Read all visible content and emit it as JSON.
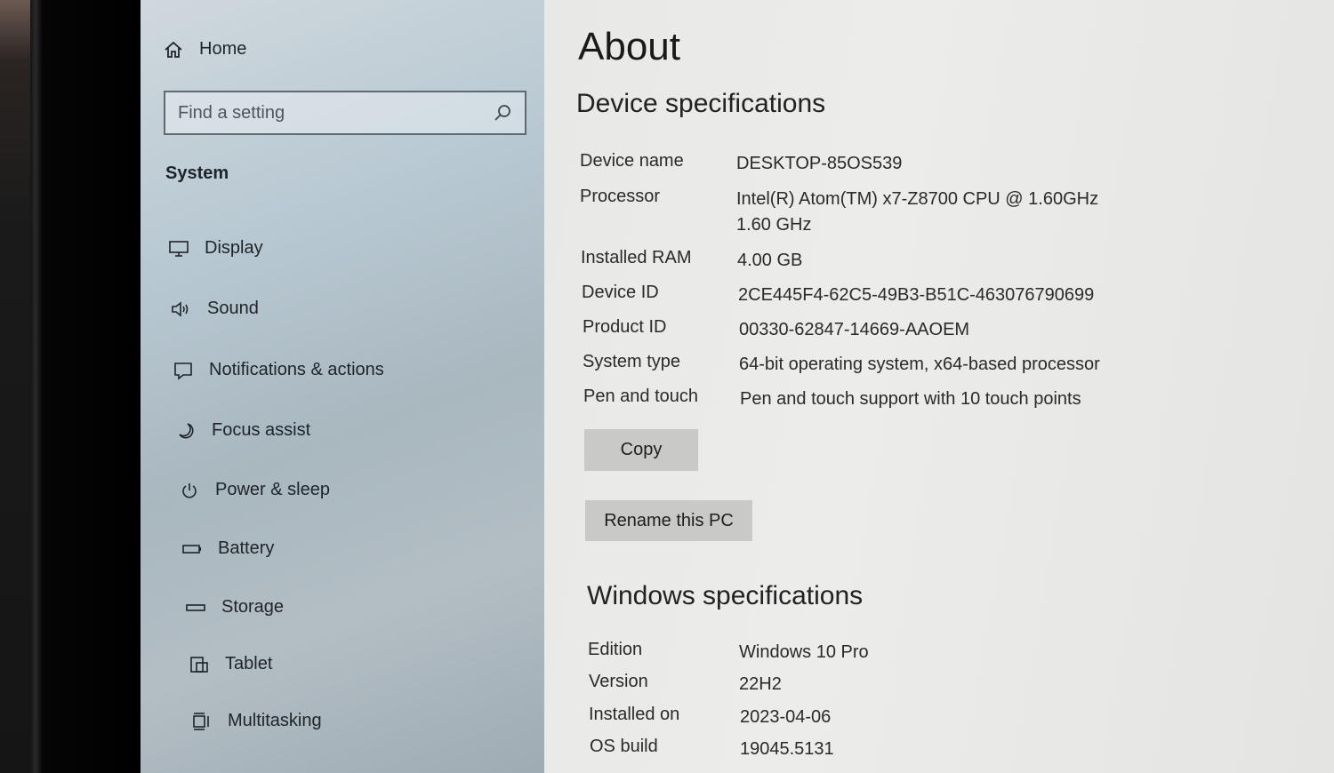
{
  "nav": {
    "home_label": "Home",
    "search_placeholder": "Find a setting",
    "section_label": "System",
    "items": [
      {
        "label": "Display",
        "icon": "monitor-icon"
      },
      {
        "label": "Sound",
        "icon": "speaker-icon"
      },
      {
        "label": "Notifications & actions",
        "icon": "notification-icon"
      },
      {
        "label": "Focus assist",
        "icon": "moon-icon"
      },
      {
        "label": "Power & sleep",
        "icon": "power-icon"
      },
      {
        "label": "Battery",
        "icon": "battery-icon"
      },
      {
        "label": "Storage",
        "icon": "storage-icon"
      },
      {
        "label": "Tablet",
        "icon": "tablet-icon"
      },
      {
        "label": "Multitasking",
        "icon": "multitasking-icon"
      }
    ]
  },
  "main": {
    "title": "About",
    "device_heading": "Device specifications",
    "device_specs": [
      {
        "key": "Device name",
        "value": "DESKTOP-85OS539"
      },
      {
        "key": "Processor",
        "value": "Intel(R) Atom(TM) x7-Z8700  CPU @ 1.60GHz",
        "value2": "1.60 GHz"
      },
      {
        "key": "Installed RAM",
        "value": "4.00 GB"
      },
      {
        "key": "Device ID",
        "value": "2CE445F4-62C5-49B3-B51C-463076790699"
      },
      {
        "key": "Product ID",
        "value": "00330-62847-14669-AAOEM"
      },
      {
        "key": "System type",
        "value": "64-bit operating system, x64-based processor"
      },
      {
        "key": "Pen and touch",
        "value": "Pen and touch support with 10 touch points"
      }
    ],
    "copy_label": "Copy",
    "rename_label": "Rename this PC",
    "windows_heading": "Windows specifications",
    "windows_specs": [
      {
        "key": "Edition",
        "value": "Windows 10 Pro"
      },
      {
        "key": "Version",
        "value": "22H2"
      },
      {
        "key": "Installed on",
        "value": "2023-04-06"
      },
      {
        "key": "OS build",
        "value": "19045.5131"
      }
    ]
  },
  "colors": {
    "nav_bg": "#b8c8d2",
    "main_bg": "#e8e8e6",
    "button_bg": "#c9c9c7"
  }
}
